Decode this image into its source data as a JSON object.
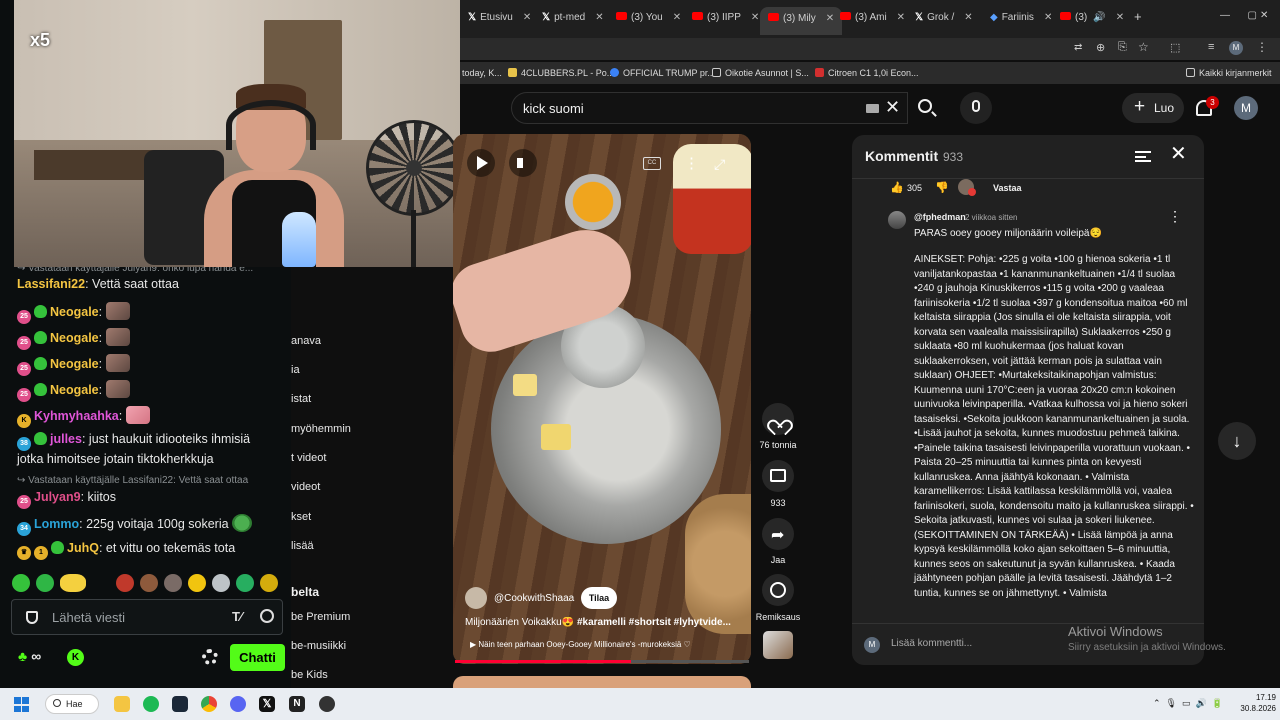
{
  "stream": {
    "multiplier": "x5",
    "messages": [
      {
        "reply": "Vastataan käyttäjälle Julyan9: onko lupa nähdä e..."
      },
      {
        "user": "Lassifani22",
        "text": "Vettä saat ottaa",
        "user_color": "#f4c542"
      },
      {
        "badge": "25",
        "user": "Neogale",
        "text": "",
        "user_color": "#f4c542"
      },
      {
        "badge": "25",
        "user": "Neogale",
        "text": "",
        "user_color": "#f4c542"
      },
      {
        "badge": "25",
        "user": "Neogale",
        "text": "",
        "user_color": "#f4c542"
      },
      {
        "badge": "25",
        "user": "Neogale",
        "text": "",
        "user_color": "#f4c542"
      },
      {
        "user": "Kyhmyhaahka",
        "text": "",
        "user_color": "#e056d8"
      },
      {
        "badge": "38",
        "user": "julles",
        "text": "just haukuit idiooteiks ihmisiä jotka himoitsee jotain tiktokherkkuja",
        "user_color": "#e056d8"
      },
      {
        "reply": "Vastataan käyttäjälle Lassifani22: Vettä saat ottaa"
      },
      {
        "badge": "25",
        "user": "Julyan9",
        "text": "kiitos",
        "user_color": "#e04f8a"
      },
      {
        "badge": "34",
        "user": "Lommo",
        "text": "225g voitaja 100g sokeria",
        "user_color": "#2aa3d8"
      },
      {
        "badge": "1",
        "user": "JuhQ",
        "text": "et vittu oo tekemäs tota",
        "user_color": "#f4c542"
      }
    ],
    "input_placeholder": "Lähetä viesti",
    "chat_button": "Chatti",
    "accent": "#53fc18"
  },
  "yt_sidebar": {
    "items": [
      "anava",
      "ia",
      "istat",
      "myöhemmin",
      "t videot",
      "videot",
      "kset",
      "lisää"
    ],
    "section": "belta",
    "section_items": [
      "be Premium",
      "be-musiikki",
      "be Kids"
    ]
  },
  "browser": {
    "tabs": [
      {
        "label": "Etusivu",
        "icon": "x"
      },
      {
        "label": "pt-med",
        "icon": "x"
      },
      {
        "label": "(3) You",
        "icon": "yt"
      },
      {
        "label": "(3) IIPP",
        "icon": "yt"
      },
      {
        "label": "(3) Mily",
        "icon": "yt",
        "active": true
      },
      {
        "label": "(3) Ami",
        "icon": "yt"
      },
      {
        "label": "Grok /",
        "icon": "x"
      },
      {
        "label": "Fariinis",
        "icon": "other"
      },
      {
        "label": "(3)",
        "icon": "yt"
      }
    ],
    "bookmarks": [
      "today, K...",
      "4CLUBBERS.PL - Po...",
      "OFFICIAL TRUMP pr...",
      "Oikotie Asunnot | S...",
      "Citroen C1 1,0i Econ..."
    ],
    "all_bookmarks": "Kaikki kirjanmerkit"
  },
  "youtube": {
    "search_query": "kick suomi",
    "create_label": "Luo",
    "notification_count": "3",
    "avatar_letter": "M",
    "short": {
      "channel": "@CookwithShaaa",
      "subscribe": "Tilaa",
      "title_plain": "Miljonäärien Voikakku😍 ",
      "title_tags": "#karamelli #shortsit #lyhytvide...",
      "subtitle": "▶ Näin teen parhaan Ooey-Gooey Millionaire's -murokeksiä ♡",
      "likes": "76 tonnia",
      "comments": "933",
      "share": "Jaa",
      "remix": "Remiksaus",
      "progress": 0.6
    },
    "comments": {
      "title": "Kommentit",
      "count": "933",
      "top_likes": "305",
      "reply_label": "Vastaa",
      "author": "@fphedman",
      "time": "2 viikkoa sitten",
      "line1": "PARAS ooey gooey miljonäärin voileipä😌",
      "body": "AINEKSET: Pohja: •225 g voita •100 g hienoa sokeria •1 tl vaniljatankopastaa •1 kananmunankeltuainen •1/4 tl suolaa •240 g jauhoja Kinuskikerros •115 g voita •200 g vaaleaa fariinisokeria •1/2 tl suolaa •397 g kondensoitua maitoa •60 ml keltaista siirappia (Jos sinulla ei ole keltaista siirappia, voit korvata sen vaalealla maissisiirapilla) Suklaakerros •250 g suklaata •80 ml kuohukermaa (jos haluat kovan suklaakerroksen, voit jättää kerman pois ja sulattaa vain suklaan) OHJEET: •Murtakeksitaikinapohjan valmistus: Kuumenna uuni 170°C:een ja vuoraa 20x20 cm:n kokoinen uunivuoka leivinpaperilla. •Vatkaa kulhossa voi ja hieno sokeri tasaiseksi. •Sekoita joukkoon kananmunankeltuainen ja suola. •Lisää jauhot ja sekoita, kunnes muodostuu pehmeä taikina. •Painele taikina tasaisesti leivinpaperilla vuorattuun vuokaan. • Paista 20–25 minuuttia tai kunnes pinta on kevyesti kullanruskea. Anna jäähtyä kokonaan. • Valmista karamellikerros: Lisää kattilassa keskilämmöllä voi, vaalea fariinisokeri, suola, kondensoitu maito ja kullanruskea siirappi. • Sekoita jatkuvasti, kunnes voi sulaa ja sokeri liukenee. (SEKOITTAMINEN ON TÄRKEÄÄ) • Lisää lämpöä ja anna kypsyä keskilämmöllä koko ajan sekoittaen 5–6 minuuttia, kunnes seos on sakeutunut ja syvän kullanruskea. • Kaada jäähtyneen pohjan päälle ja levitä tasaisesti. Jäähdytä 1–2 tuntia, kunnes se on jähmettynyt. • Valmista",
      "add_placeholder": "Lisää kommentti..."
    }
  },
  "windows": {
    "activate_title": "Aktivoi Windows",
    "activate_sub": "Siirry asetuksiin ja aktivoi Windows.",
    "search_label": "Hae",
    "time": "17.19",
    "date": "30.8.2026"
  }
}
